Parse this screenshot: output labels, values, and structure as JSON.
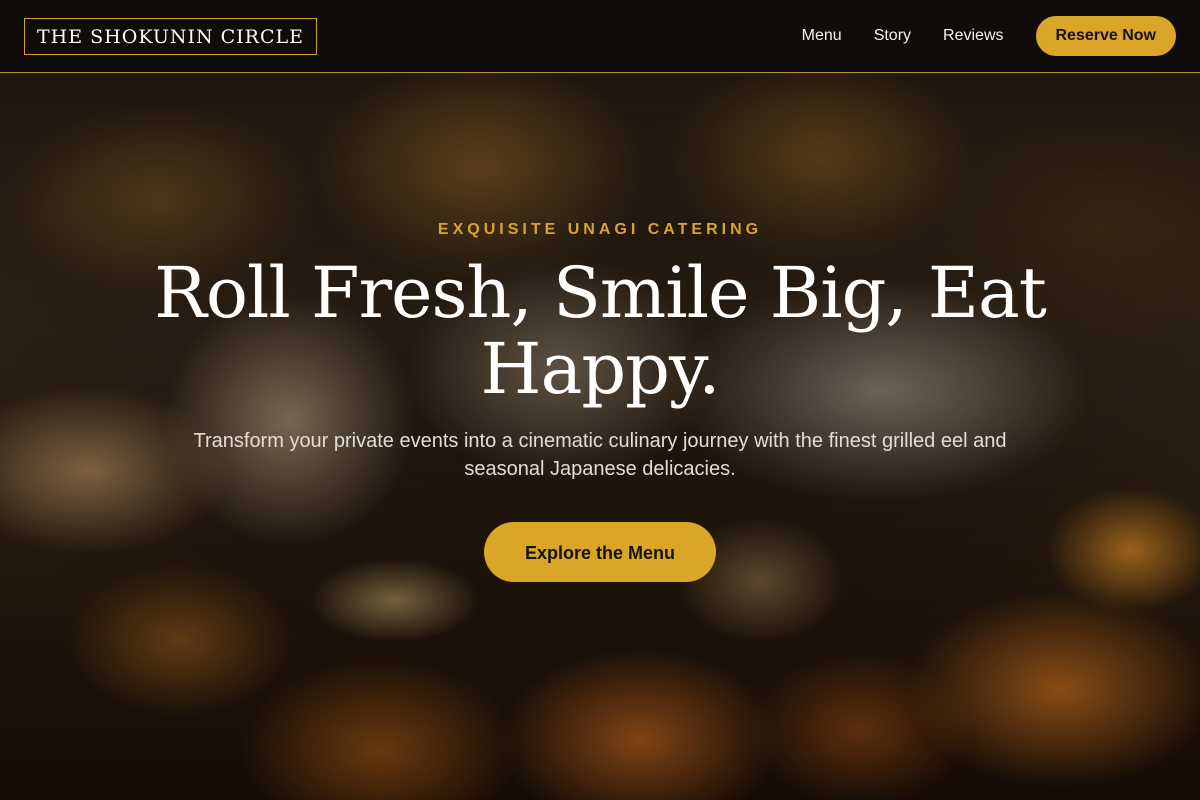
{
  "header": {
    "logo_text": "THE SHOKUNIN CIRCLE",
    "nav": [
      {
        "label": "Menu"
      },
      {
        "label": "Story"
      },
      {
        "label": "Reviews"
      }
    ],
    "reserve_label": "Reserve Now"
  },
  "hero": {
    "eyebrow": "EXQUISITE UNAGI CATERING",
    "headline": "Roll Fresh, Smile Big, Eat Happy.",
    "subtext": "Transform your private events into a cinematic culinary journey with the finest grilled eel and seasonal Japanese delicacies.",
    "cta_label": "Explore the Menu"
  },
  "colors": {
    "accent": "#dba527",
    "header_bg": "#0e0c0a",
    "eyebrow": "#d9a333"
  }
}
